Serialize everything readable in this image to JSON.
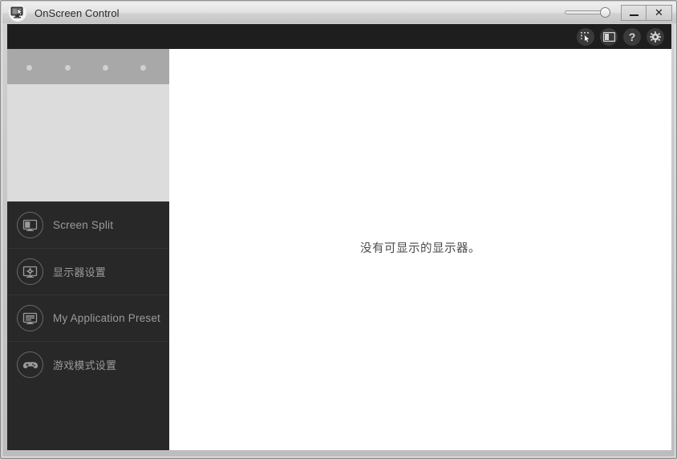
{
  "window": {
    "title": "OnScreen Control",
    "app_icon": "monitor-cursor-icon",
    "opacity_slider_value": 100,
    "controls": [
      {
        "name": "minimize",
        "glyph": "—",
        "label": "Minimize"
      },
      {
        "name": "close",
        "glyph": "✕",
        "label": "Close"
      }
    ]
  },
  "toolbar": {
    "buttons": [
      {
        "name": "pointer-select-icon",
        "label": "Screen Capture / Pointer"
      },
      {
        "name": "split-screen-icon",
        "label": "Screen Split Layout"
      },
      {
        "name": "help-icon",
        "label": "?"
      },
      {
        "name": "gear-icon",
        "label": "Settings"
      }
    ],
    "help_glyph": "?"
  },
  "sidebar": {
    "preview": {
      "name": "monitor-preview",
      "dot_count": 4
    },
    "items": [
      {
        "label": "Screen Split",
        "icon": "screen-split-icon",
        "cjk": false,
        "selected": false
      },
      {
        "label": "显示器设置",
        "icon": "monitor-settings-icon",
        "cjk": true,
        "selected": false
      },
      {
        "label": "My Application Preset",
        "icon": "application-preset-icon",
        "cjk": false,
        "selected": false
      },
      {
        "label": "游戏模式设置",
        "icon": "gamepad-icon",
        "cjk": true,
        "selected": false
      }
    ]
  },
  "main": {
    "empty_message": "没有可显示的显示器。"
  },
  "colors": {
    "toolbar_bg": "#1e1e1e",
    "sidebar_bg": "#282828",
    "main_bg": "#ffffff",
    "nav_label": "#9b9b9b",
    "preview_top": "#a8a8a8",
    "preview_body": "#dcdcdc",
    "frame": "#c8c8c8"
  }
}
